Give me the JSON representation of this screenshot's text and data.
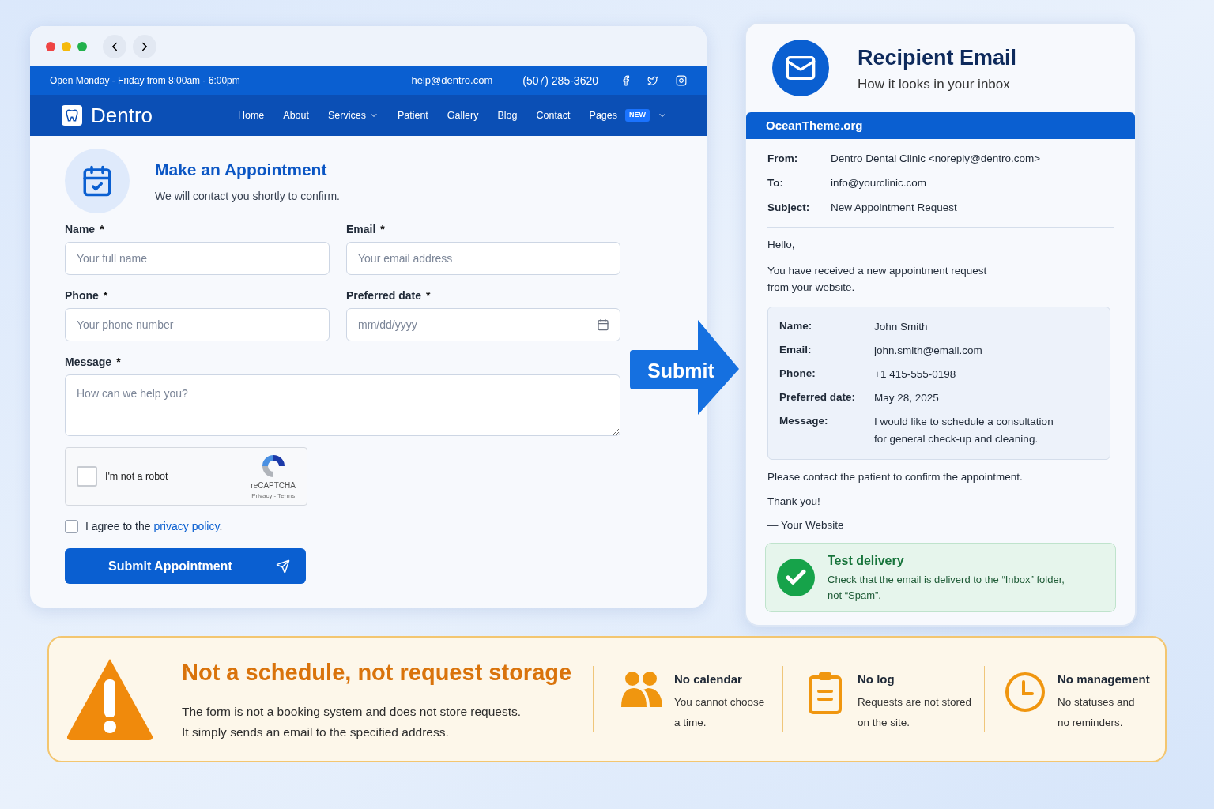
{
  "browser": {
    "topbar": {
      "hours": "Open Monday - Friday from 8:00am - 6:00pm",
      "email": "help@dentro.com",
      "phone": "(507) 285-3620"
    },
    "brand": "Dentro",
    "nav": [
      {
        "label": "Home",
        "dropdown": false
      },
      {
        "label": "About",
        "dropdown": false
      },
      {
        "label": "Services",
        "dropdown": true
      },
      {
        "label": "Patient",
        "dropdown": false
      },
      {
        "label": "Gallery",
        "dropdown": false
      },
      {
        "label": "Blog",
        "dropdown": false
      },
      {
        "label": "Contact",
        "dropdown": false
      },
      {
        "label": "Pages",
        "dropdown": true,
        "badge": "NEW"
      }
    ],
    "form": {
      "title": "Make an Appointment",
      "subtitle": "We will contact you shortly to confirm.",
      "fields": [
        {
          "label": "Name",
          "required": "*",
          "placeholder": "Your full name",
          "kind": "text"
        },
        {
          "label": "Email",
          "required": "*",
          "placeholder": "Your email address",
          "kind": "text"
        },
        {
          "label": "Phone",
          "required": "*",
          "placeholder": "Your phone number",
          "kind": "text"
        },
        {
          "label": "Preferred date",
          "required": "*",
          "placeholder": "mm/dd/yyyy",
          "kind": "date"
        },
        {
          "label": "Message",
          "required": "*",
          "placeholder": "How can we help you?",
          "kind": "textarea"
        }
      ],
      "captcha": {
        "label": "I'm not a robot",
        "checked": false,
        "brand": "reCAPTCHA",
        "links": "Privacy - Terms"
      },
      "agree": {
        "text": "I agree to the ",
        "link": "privacy policy",
        "end": ".",
        "checked": false
      },
      "submit": "Submit Appointment"
    }
  },
  "arrow": "Submit",
  "email": {
    "title": "Recipient Email",
    "subtitle": "How it looks in your inbox",
    "bar": "OceanTheme.org",
    "headers": [
      {
        "label": "From:",
        "value": "Dentro Dental Clinic <noreply@dentro.com>"
      },
      {
        "label": "To:",
        "value": "info@yourclinic.com"
      },
      {
        "label": "Subject:",
        "value": "New Appointment Request"
      }
    ],
    "greeting": "Hello,",
    "intro": [
      "You have received a new appointment request",
      "from your website."
    ],
    "details": [
      {
        "label": "Name:",
        "value": [
          "John Smith"
        ]
      },
      {
        "label": "Email:",
        "value": [
          "john.smith@email.com"
        ]
      },
      {
        "label": "Phone:",
        "value": [
          "+1 415-555-0198"
        ]
      },
      {
        "label": "Preferred date:",
        "value": [
          "May 28, 2025"
        ]
      },
      {
        "label": "Message:",
        "value": [
          "I would like to schedule a consultation",
          "for general check-up and cleaning."
        ]
      }
    ],
    "closing": "Please contact the patient to confirm the appointment.",
    "thanks": "Thank you!",
    "signature": "— Your Website",
    "notice": {
      "title": "Test delivery",
      "text": [
        "Check that the email is deliverd to the “Inbox” folder,",
        "not “Spam”."
      ]
    }
  },
  "banner": {
    "title": "Not a schedule, not request storage",
    "text": [
      "The form is not a booking system and does not store requests.",
      "It simply sends an email to the specified address."
    ],
    "items": [
      {
        "kind": "people",
        "title": "No calendar",
        "text": [
          "You cannot choose",
          "a time."
        ]
      },
      {
        "kind": "clipboard",
        "title": "No log",
        "text": [
          "Requests are not stored",
          "on the site."
        ]
      },
      {
        "kind": "clock",
        "title": "No management",
        "text": [
          "No statuses and",
          "no reminders."
        ]
      }
    ]
  }
}
